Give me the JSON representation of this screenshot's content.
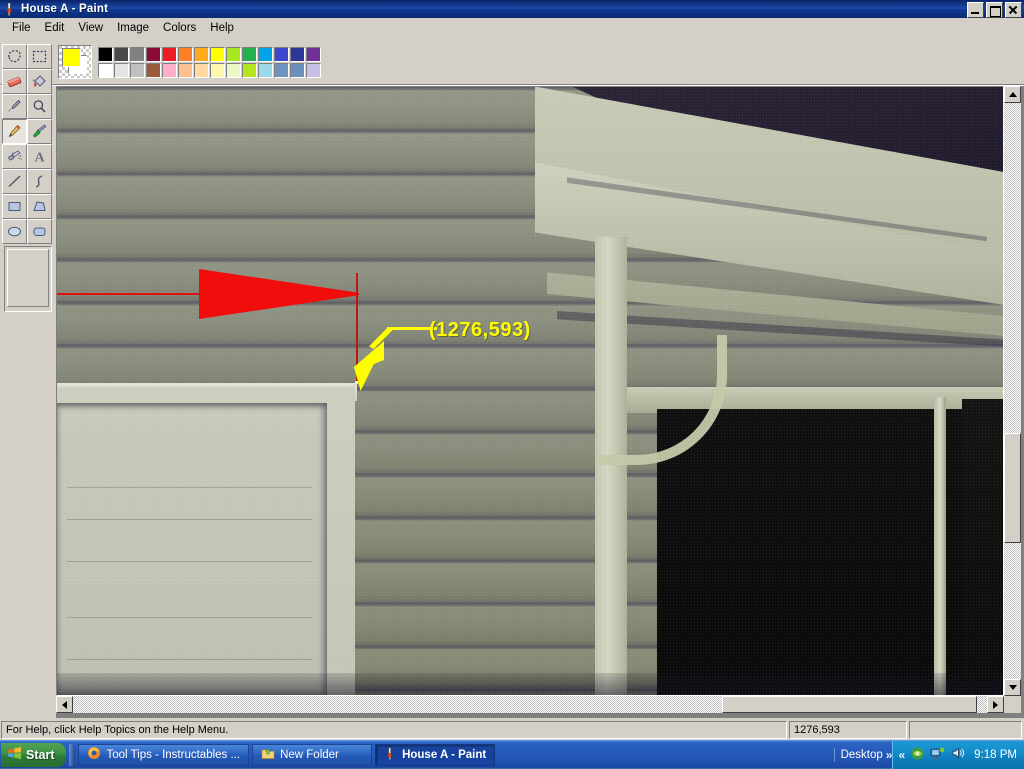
{
  "window": {
    "title": "House A - Paint",
    "icon": "paint-icon",
    "buttons": {
      "minimize": "Minimize",
      "maximize": "Restore",
      "close": "Close"
    }
  },
  "menu": {
    "items": [
      "File",
      "Edit",
      "View",
      "Image",
      "Colors",
      "Help"
    ]
  },
  "tools": {
    "selected": "pencil",
    "items": [
      {
        "name": "free-form-select",
        "label": "Free-Form Select"
      },
      {
        "name": "select",
        "label": "Select"
      },
      {
        "name": "eraser",
        "label": "Eraser/Color Eraser"
      },
      {
        "name": "fill-with-color",
        "label": "Fill With Color"
      },
      {
        "name": "pick-color",
        "label": "Pick Color"
      },
      {
        "name": "magnifier",
        "label": "Magnifier"
      },
      {
        "name": "pencil",
        "label": "Pencil"
      },
      {
        "name": "brush",
        "label": "Brush"
      },
      {
        "name": "airbrush",
        "label": "Airbrush"
      },
      {
        "name": "text",
        "label": "Text"
      },
      {
        "name": "line",
        "label": "Line"
      },
      {
        "name": "curve",
        "label": "Curve"
      },
      {
        "name": "rectangle",
        "label": "Rectangle"
      },
      {
        "name": "polygon",
        "label": "Polygon"
      },
      {
        "name": "ellipse",
        "label": "Ellipse"
      },
      {
        "name": "rounded-rectangle",
        "label": "Rounded Rectangle"
      }
    ]
  },
  "colors": {
    "foreground": "#ffff00",
    "background": "#ffffff",
    "row1": [
      "#000000",
      "#484848",
      "#808080",
      "#8b0b38",
      "#ed1c24",
      "#ff7f27",
      "#ffaa1d",
      "#ffff00",
      "#a8e61d",
      "#22b14c",
      "#00a2e8",
      "#3f48cc",
      "#2f3699",
      "#6f3198"
    ],
    "row2": [
      "#ffffff",
      "#e4e4e4",
      "#c0c0c0",
      "#9c5a3c",
      "#ffaec9",
      "#ffc090",
      "#ffd9a0",
      "#fff6b0",
      "#ecf7c8",
      "#b5e61d",
      "#99d9ea",
      "#7092be",
      "#6c8fbf",
      "#c8bfe7"
    ]
  },
  "canvas": {
    "image_subject": "House A photo - vinyl siding, soffit, gutter, garage door and dark porch opening",
    "annotations": {
      "red_arrow": {
        "name": "red-arrow-marker",
        "color": "#f20d0d"
      },
      "yellow_arrow": {
        "name": "yellow-arrow-marker",
        "color": "#ffff00"
      },
      "coordinate_label": "(1276,593)"
    }
  },
  "scrollbars": {
    "vertical": {
      "up": "Scroll up",
      "down": "Scroll down",
      "thumb_top_pct": 54,
      "thumb_height_pct": 18
    },
    "horizontal": {
      "left": "Scroll left",
      "right": "Scroll right",
      "thumb_left_pct": 71,
      "thumb_width_pct": 27
    }
  },
  "status_bar": {
    "help_text": "For Help, click Help Topics on the Help Menu.",
    "coordinates": "1276,593",
    "size": ""
  },
  "taskbar": {
    "start_label": "Start",
    "tasks": [
      {
        "label": "Tool Tips - Instructables ...",
        "icon": "firefox-icon",
        "active": false
      },
      {
        "label": "New Folder",
        "icon": "folder-icon",
        "active": false
      },
      {
        "label": "House A - Paint",
        "icon": "paint-icon",
        "active": true
      }
    ],
    "deskband_label": "Desktop",
    "overflow_glyph": "»",
    "tray_expand_glyph": "«",
    "tray_icons": [
      "shield-icon",
      "network-icon",
      "volume-icon"
    ],
    "clock": "9:18 PM"
  }
}
